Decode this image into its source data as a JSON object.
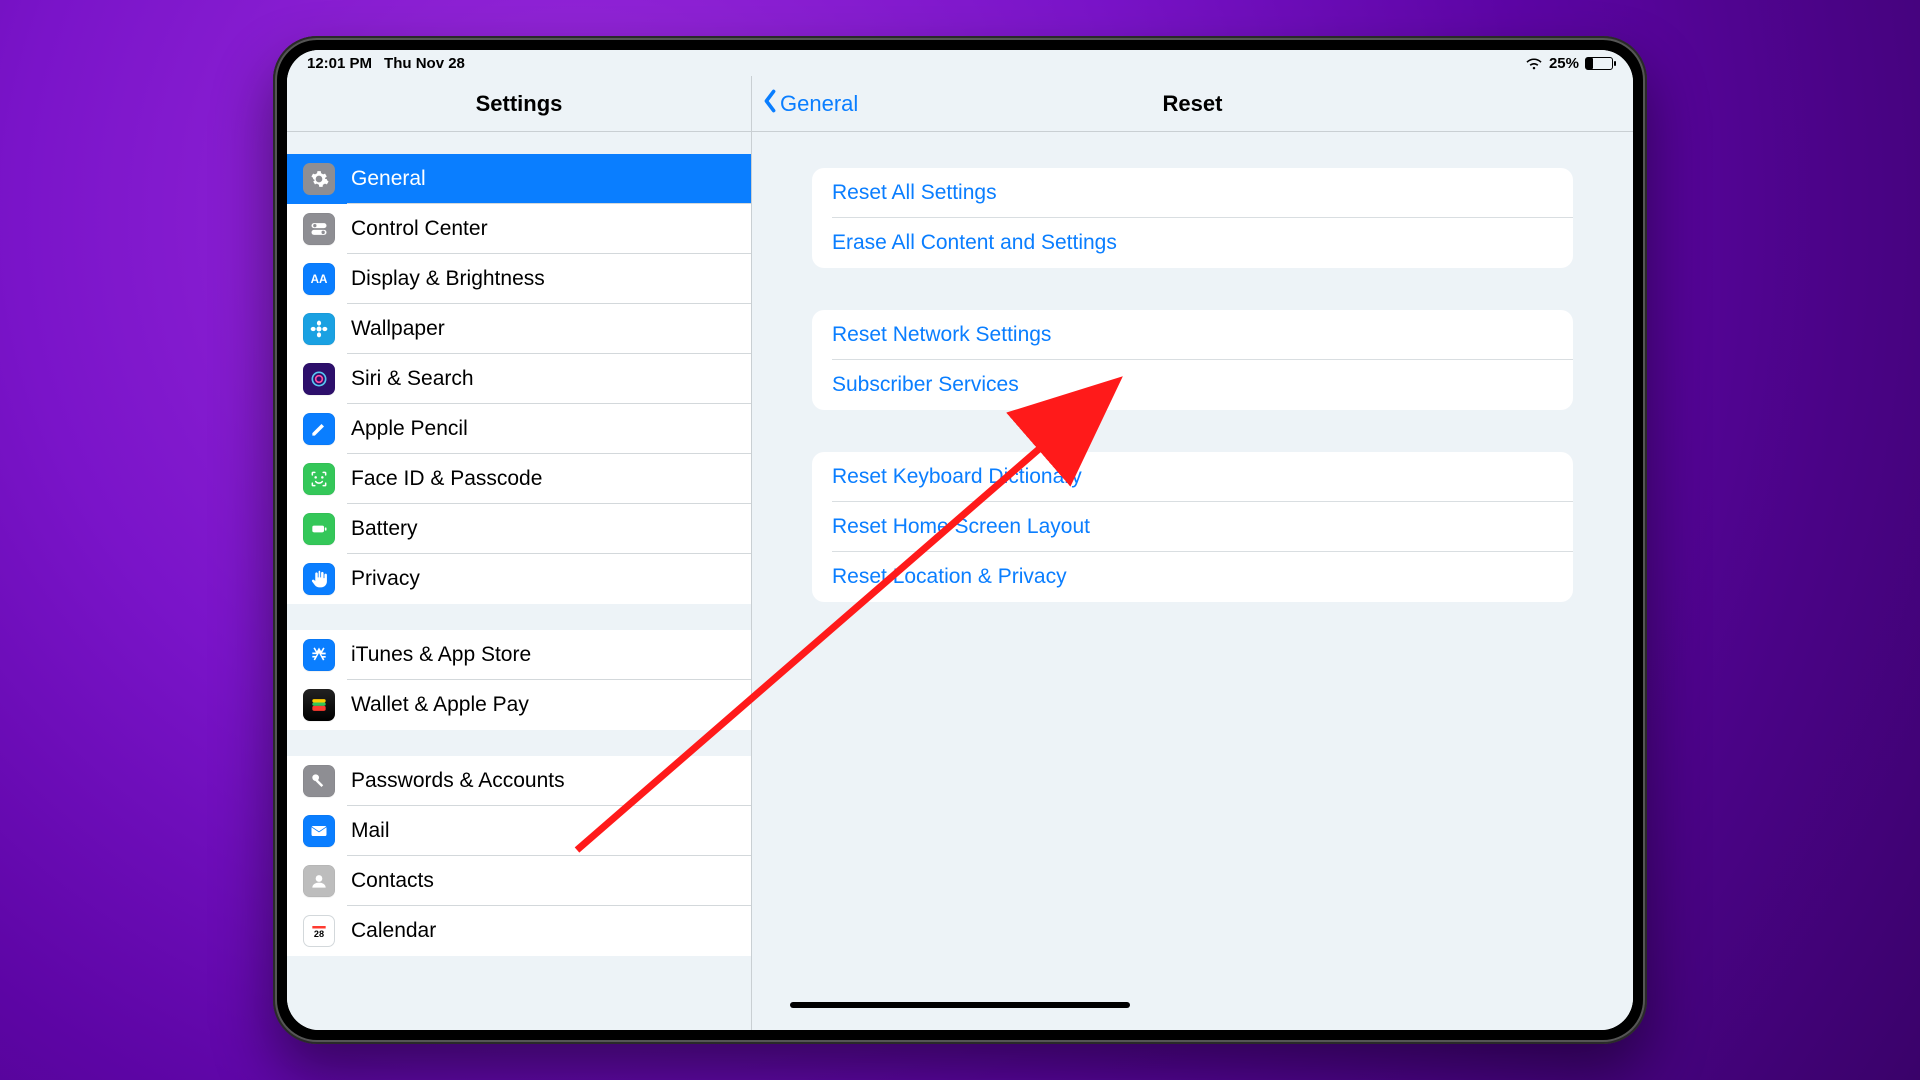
{
  "status": {
    "time": "12:01 PM",
    "date": "Thu Nov 28",
    "battery_text": "25%",
    "battery_level": 25
  },
  "sidebar": {
    "title": "Settings",
    "groups": [
      [
        {
          "id": "general",
          "label": "General",
          "icon": "gear",
          "selected": true
        },
        {
          "id": "control",
          "label": "Control Center",
          "icon": "toggles",
          "selected": false
        },
        {
          "id": "display",
          "label": "Display & Brightness",
          "icon": "aa",
          "selected": false
        },
        {
          "id": "wallpaper",
          "label": "Wallpaper",
          "icon": "flower",
          "selected": false
        },
        {
          "id": "siri",
          "label": "Siri & Search",
          "icon": "siri",
          "selected": false
        },
        {
          "id": "pencil",
          "label": "Apple Pencil",
          "icon": "pencil",
          "selected": false
        },
        {
          "id": "faceid",
          "label": "Face ID & Passcode",
          "icon": "face",
          "selected": false
        },
        {
          "id": "battery",
          "label": "Battery",
          "icon": "battery",
          "selected": false
        },
        {
          "id": "privacy",
          "label": "Privacy",
          "icon": "hand",
          "selected": false
        }
      ],
      [
        {
          "id": "itunes",
          "label": "iTunes & App Store",
          "icon": "astore",
          "selected": false
        },
        {
          "id": "wallet",
          "label": "Wallet & Apple Pay",
          "icon": "wallet",
          "selected": false
        }
      ],
      [
        {
          "id": "passwords",
          "label": "Passwords & Accounts",
          "icon": "key",
          "selected": false
        },
        {
          "id": "mail",
          "label": "Mail",
          "icon": "envelope",
          "selected": false
        },
        {
          "id": "contacts",
          "label": "Contacts",
          "icon": "contacts",
          "selected": false
        },
        {
          "id": "calendar",
          "label": "Calendar",
          "icon": "calendar",
          "selected": false
        }
      ]
    ]
  },
  "detail": {
    "back_label": "General",
    "title": "Reset",
    "groups": [
      [
        {
          "id": "reset-all",
          "label": "Reset All Settings"
        },
        {
          "id": "erase-all",
          "label": "Erase All Content and Settings"
        }
      ],
      [
        {
          "id": "reset-network",
          "label": "Reset Network Settings"
        },
        {
          "id": "subscriber",
          "label": "Subscriber Services"
        }
      ],
      [
        {
          "id": "reset-keyboard",
          "label": "Reset Keyboard Dictionary"
        },
        {
          "id": "reset-home",
          "label": "Reset Home Screen Layout"
        },
        {
          "id": "reset-location",
          "label": "Reset Location & Privacy"
        }
      ]
    ]
  },
  "icon_class": {
    "gear": "ic-gray",
    "toggles": "ic-gray",
    "aa": "ic-blue",
    "flower": "ic-cyan",
    "siri": "ic-indigo",
    "pencil": "ic-blue",
    "face": "ic-green",
    "battery": "ic-green",
    "hand": "ic-hand",
    "astore": "ic-astore",
    "wallet": "ic-wallet",
    "key": "ic-gray",
    "envelope": "ic-envelope",
    "contacts": "ic-contacts",
    "calendar": "ic-calendar"
  },
  "annotation": {
    "arrow_target": "reset-all"
  }
}
